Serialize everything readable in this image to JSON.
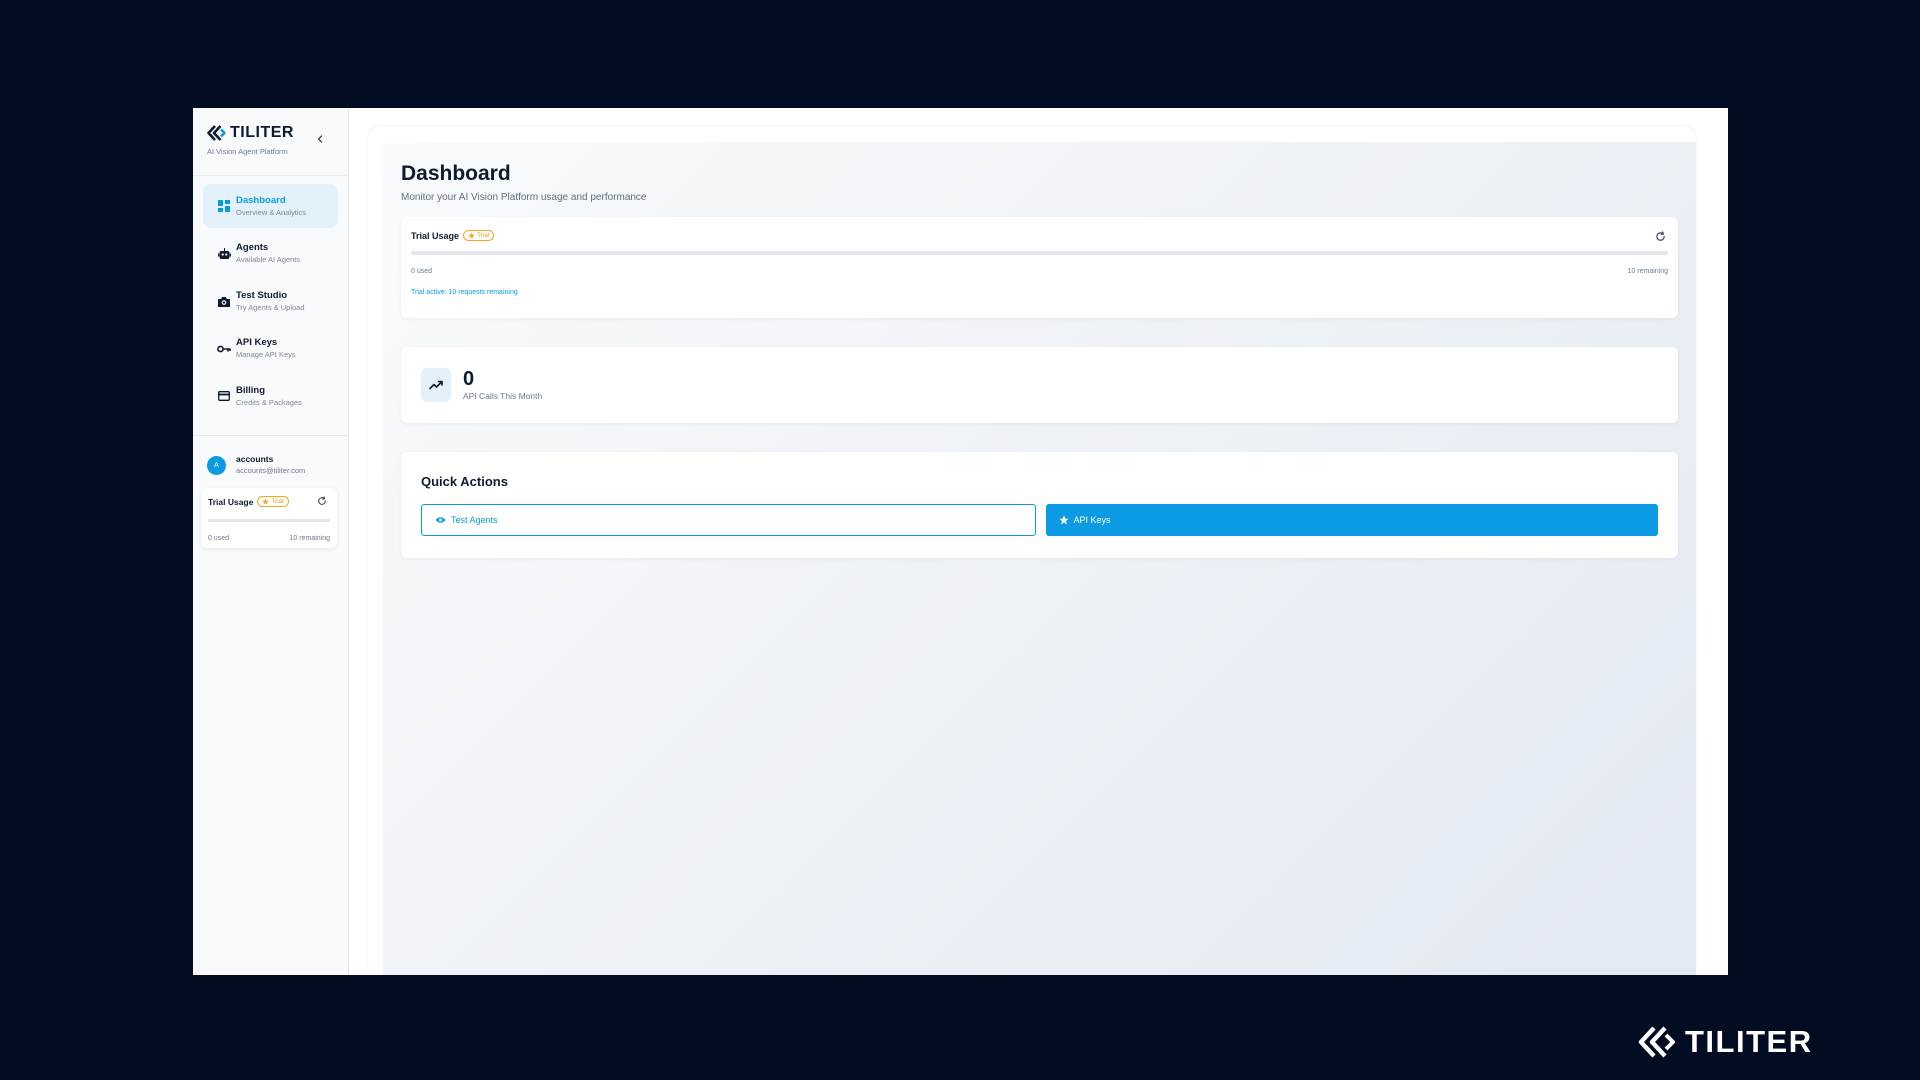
{
  "brand": {
    "name": "TILITER",
    "subtitle": "AI Vision Agent Platform"
  },
  "sidebar": {
    "items": [
      {
        "title": "Dashboard",
        "subtitle": "Overview & Analytics",
        "icon": "grid-icon",
        "active": true
      },
      {
        "title": "Agents",
        "subtitle": "Available AI Agents",
        "icon": "robot-icon"
      },
      {
        "title": "Test Studio",
        "subtitle": "Try Agents & Upload",
        "icon": "camera-icon"
      },
      {
        "title": "API Keys",
        "subtitle": "Manage API Keys",
        "icon": "key-icon"
      },
      {
        "title": "Billing",
        "subtitle": "Credits & Packages",
        "icon": "credit-card-icon"
      }
    ],
    "user": {
      "avatar_letter": "A",
      "name": "accounts",
      "email": "accounts@tiliter.com"
    },
    "trial": {
      "title": "Trial Usage",
      "badge": "Trial",
      "used": "0 used",
      "remaining": "10 remaining",
      "progress": 0
    }
  },
  "main": {
    "title": "Dashboard",
    "subtitle": "Monitor your AI Vision Platform usage and performance",
    "trial": {
      "title": "Trial Usage",
      "badge": "Trial",
      "used": "0 used",
      "remaining": "10 remaining",
      "status": "Trial active: 10 requests remaining",
      "progress": 0
    },
    "stat": {
      "value": "0",
      "label": "API Calls This Month",
      "icon": "trending-up-icon"
    },
    "quick_actions": {
      "title": "Quick Actions",
      "test_agents": "Test Agents",
      "api_keys": "API Keys"
    }
  },
  "footer": {
    "brand": "TILITER"
  },
  "colors": {
    "accent": "#0b9be4",
    "badge": "#f5a524",
    "background": "#020d24"
  }
}
